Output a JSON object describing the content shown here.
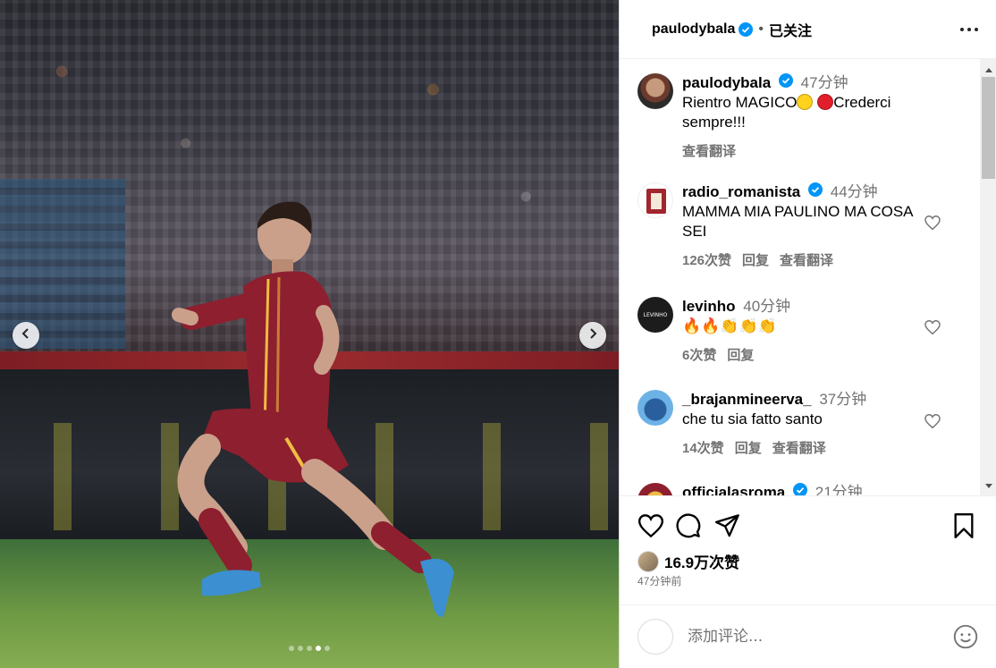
{
  "post": {
    "username": "paulodybala",
    "separator": "•",
    "follow_status": "已关注",
    "caption_user": "paulodybala",
    "caption_time": "47分钟",
    "caption_text_1": "Rientro MAGICO",
    "caption_text_2": "Crederci sempre!!!",
    "caption_translate": "查看翻译"
  },
  "carousel": {
    "count": 5,
    "active_index": 3
  },
  "comments": [
    {
      "user": "radio_romanista",
      "verified": true,
      "time": "44分钟",
      "text": "MAMMA MIA PAULINO MA COSA SEI",
      "likes": "126次赞",
      "reply": "回复",
      "translate": "查看翻译"
    },
    {
      "user": "levinho",
      "verified": false,
      "time": "40分钟",
      "text": "🔥🔥👏👏👏",
      "likes": "6次赞",
      "reply": "回复"
    },
    {
      "user": "_brajanmineerva_",
      "verified": false,
      "time": "37分钟",
      "text": "che tu sia fatto santo",
      "likes": "14次赞",
      "reply": "回复",
      "translate": "查看翻译"
    },
    {
      "user": "officialasroma",
      "verified": true,
      "time": "21分钟"
    }
  ],
  "likes_summary": "16.9万次赞",
  "posted_ago": "47分钟前",
  "add_comment": {
    "placeholder": "添加评论..."
  },
  "avatar_labels": {
    "levinho": "LEVINHO"
  },
  "colors": {
    "verified": "#0095f6",
    "roma_red": "#8e1f2f",
    "roma_gold": "#f0bc42",
    "muted": "#737373"
  },
  "icons": [
    "chevron-left-icon",
    "chevron-right-icon",
    "more-icon",
    "verified-icon",
    "heart-icon",
    "comment-icon",
    "share-icon",
    "bookmark-icon",
    "emoji-icon"
  ]
}
